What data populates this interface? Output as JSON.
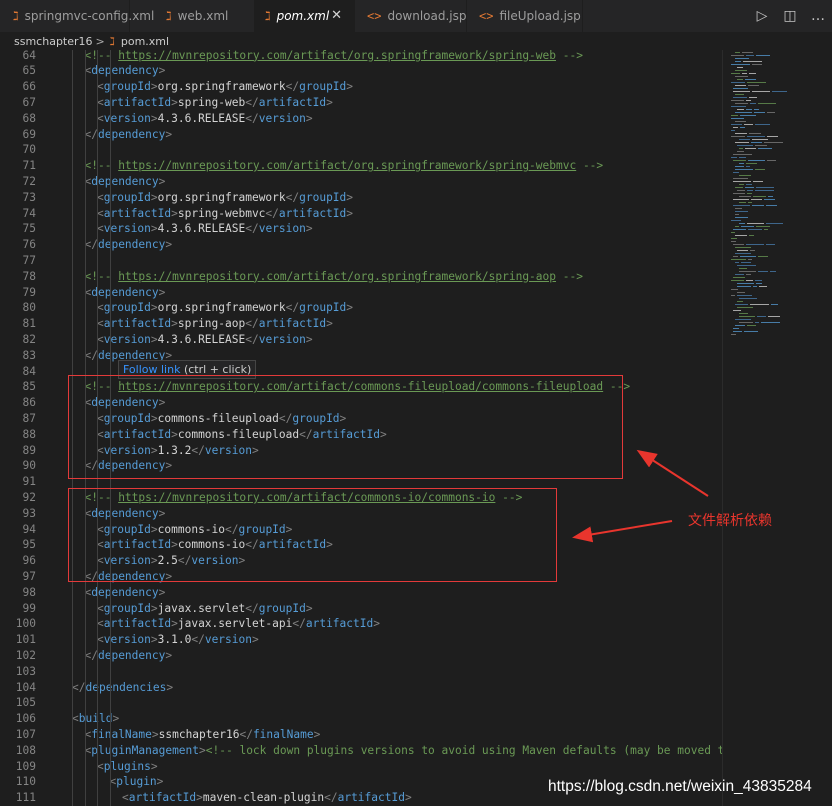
{
  "tabs": [
    {
      "label": "springmvc-config.xml",
      "icon": "xml-file-icon",
      "active": false
    },
    {
      "label": "web.xml",
      "icon": "xml-file-icon",
      "active": false
    },
    {
      "label": "pom.xml",
      "icon": "xml-file-icon",
      "active": true
    },
    {
      "label": "download.jsp",
      "icon": "jsp-file-icon",
      "active": false
    },
    {
      "label": "fileUpload.jsp",
      "icon": "jsp-file-icon",
      "active": false
    }
  ],
  "tab_actions": [
    {
      "icon": "run-icon"
    },
    {
      "icon": "split-editor-icon"
    },
    {
      "icon": "more-actions-icon"
    }
  ],
  "breadcrumb": {
    "folder": "ssmchapter16",
    "separator": ">",
    "file": "pom.xml"
  },
  "tooltip": {
    "link": "Follow link",
    "hint": "(ctrl + click)"
  },
  "annotation": "文件解析依赖",
  "watermark": "https://blog.csdn.net/weixin_43835284",
  "colors": {
    "tag": "#569cd6",
    "comment": "#6a9955",
    "text": "#d4d4d4",
    "punct": "#808080",
    "highlight_box": "#e33a3a",
    "annotation": "#e8352d"
  },
  "lines": [
    {
      "num": "64",
      "indent": 1,
      "tokens": [
        [
          "c",
          "<!-- "
        ],
        [
          "u",
          "https://mvnrepository.com/artifact/org.springframework/spring-web"
        ],
        [
          "c",
          " -->"
        ]
      ]
    },
    {
      "num": "65",
      "indent": 1,
      "tokens": [
        [
          "p",
          "<"
        ],
        [
          "t",
          "dependency"
        ],
        [
          "p",
          ">"
        ]
      ]
    },
    {
      "num": "66",
      "indent": 2,
      "tokens": [
        [
          "p",
          "<"
        ],
        [
          "t",
          "groupId"
        ],
        [
          "p",
          ">"
        ],
        [
          "txt",
          "org.springframework"
        ],
        [
          "p",
          "</"
        ],
        [
          "t",
          "groupId"
        ],
        [
          "p",
          ">"
        ]
      ]
    },
    {
      "num": "67",
      "indent": 2,
      "tokens": [
        [
          "p",
          "<"
        ],
        [
          "t",
          "artifactId"
        ],
        [
          "p",
          ">"
        ],
        [
          "txt",
          "spring-web"
        ],
        [
          "p",
          "</"
        ],
        [
          "t",
          "artifactId"
        ],
        [
          "p",
          ">"
        ]
      ]
    },
    {
      "num": "68",
      "indent": 2,
      "tokens": [
        [
          "p",
          "<"
        ],
        [
          "t",
          "version"
        ],
        [
          "p",
          ">"
        ],
        [
          "txt",
          "4.3.6.RELEASE"
        ],
        [
          "p",
          "</"
        ],
        [
          "t",
          "version"
        ],
        [
          "p",
          ">"
        ]
      ]
    },
    {
      "num": "69",
      "indent": 1,
      "tokens": [
        [
          "p",
          "</"
        ],
        [
          "t",
          "dependency"
        ],
        [
          "p",
          ">"
        ]
      ]
    },
    {
      "num": "70",
      "indent": 0,
      "tokens": []
    },
    {
      "num": "71",
      "indent": 1,
      "tokens": [
        [
          "c",
          "<!-- "
        ],
        [
          "u",
          "https://mvnrepository.com/artifact/org.springframework/spring-webmvc"
        ],
        [
          "c",
          " -->"
        ]
      ]
    },
    {
      "num": "72",
      "indent": 1,
      "tokens": [
        [
          "p",
          "<"
        ],
        [
          "t",
          "dependency"
        ],
        [
          "p",
          ">"
        ]
      ]
    },
    {
      "num": "73",
      "indent": 2,
      "tokens": [
        [
          "p",
          "<"
        ],
        [
          "t",
          "groupId"
        ],
        [
          "p",
          ">"
        ],
        [
          "txt",
          "org.springframework"
        ],
        [
          "p",
          "</"
        ],
        [
          "t",
          "groupId"
        ],
        [
          "p",
          ">"
        ]
      ]
    },
    {
      "num": "74",
      "indent": 2,
      "tokens": [
        [
          "p",
          "<"
        ],
        [
          "t",
          "artifactId"
        ],
        [
          "p",
          ">"
        ],
        [
          "txt",
          "spring-webmvc"
        ],
        [
          "p",
          "</"
        ],
        [
          "t",
          "artifactId"
        ],
        [
          "p",
          ">"
        ]
      ]
    },
    {
      "num": "75",
      "indent": 2,
      "tokens": [
        [
          "p",
          "<"
        ],
        [
          "t",
          "version"
        ],
        [
          "p",
          ">"
        ],
        [
          "txt",
          "4.3.6.RELEASE"
        ],
        [
          "p",
          "</"
        ],
        [
          "t",
          "version"
        ],
        [
          "p",
          ">"
        ]
      ]
    },
    {
      "num": "76",
      "indent": 1,
      "tokens": [
        [
          "p",
          "</"
        ],
        [
          "t",
          "dependency"
        ],
        [
          "p",
          ">"
        ]
      ]
    },
    {
      "num": "77",
      "indent": 0,
      "tokens": []
    },
    {
      "num": "78",
      "indent": 1,
      "tokens": [
        [
          "c",
          "<!-- "
        ],
        [
          "u",
          "https://mvnrepository.com/artifact/org.springframework/spring-aop"
        ],
        [
          "c",
          " -->"
        ]
      ]
    },
    {
      "num": "79",
      "indent": 1,
      "tokens": [
        [
          "p",
          "<"
        ],
        [
          "t",
          "dependency"
        ],
        [
          "p",
          ">"
        ]
      ]
    },
    {
      "num": "80",
      "indent": 2,
      "tokens": [
        [
          "p",
          "<"
        ],
        [
          "t",
          "groupId"
        ],
        [
          "p",
          ">"
        ],
        [
          "txt",
          "org.springframework"
        ],
        [
          "p",
          "</"
        ],
        [
          "t",
          "groupId"
        ],
        [
          "p",
          ">"
        ]
      ]
    },
    {
      "num": "81",
      "indent": 2,
      "tokens": [
        [
          "p",
          "<"
        ],
        [
          "t",
          "artifactId"
        ],
        [
          "p",
          ">"
        ],
        [
          "txt",
          "spring-aop"
        ],
        [
          "p",
          "</"
        ],
        [
          "t",
          "artifactId"
        ],
        [
          "p",
          ">"
        ]
      ]
    },
    {
      "num": "82",
      "indent": 2,
      "tokens": [
        [
          "p",
          "<"
        ],
        [
          "t",
          "version"
        ],
        [
          "p",
          ">"
        ],
        [
          "txt",
          "4.3.6.RELEASE"
        ],
        [
          "p",
          "</"
        ],
        [
          "t",
          "version"
        ],
        [
          "p",
          ">"
        ]
      ]
    },
    {
      "num": "83",
      "indent": 1,
      "tokens": [
        [
          "p",
          "</"
        ],
        [
          "t",
          "dependency"
        ],
        [
          "p",
          ">"
        ]
      ]
    },
    {
      "num": "84",
      "indent": 0,
      "tokens": []
    },
    {
      "num": "85",
      "indent": 1,
      "tokens": [
        [
          "c",
          "<!-- "
        ],
        [
          "u",
          "https://mvnrepository.com/artifact/commons-fileupload/commons-fileupload"
        ],
        [
          "c",
          " -->"
        ]
      ]
    },
    {
      "num": "86",
      "indent": 1,
      "tokens": [
        [
          "p",
          "<"
        ],
        [
          "t",
          "dependency"
        ],
        [
          "p",
          ">"
        ]
      ]
    },
    {
      "num": "87",
      "indent": 2,
      "tokens": [
        [
          "p",
          "<"
        ],
        [
          "t",
          "groupId"
        ],
        [
          "p",
          ">"
        ],
        [
          "txt",
          "commons-fileupload"
        ],
        [
          "p",
          "</"
        ],
        [
          "t",
          "groupId"
        ],
        [
          "p",
          ">"
        ]
      ]
    },
    {
      "num": "88",
      "indent": 2,
      "tokens": [
        [
          "p",
          "<"
        ],
        [
          "t",
          "artifactId"
        ],
        [
          "p",
          ">"
        ],
        [
          "txt",
          "commons-fileupload"
        ],
        [
          "p",
          "</"
        ],
        [
          "t",
          "artifactId"
        ],
        [
          "p",
          ">"
        ]
      ]
    },
    {
      "num": "89",
      "indent": 2,
      "tokens": [
        [
          "p",
          "<"
        ],
        [
          "t",
          "version"
        ],
        [
          "p",
          ">"
        ],
        [
          "txt",
          "1.3.2"
        ],
        [
          "p",
          "</"
        ],
        [
          "t",
          "version"
        ],
        [
          "p",
          ">"
        ]
      ]
    },
    {
      "num": "90",
      "indent": 1,
      "tokens": [
        [
          "p",
          "</"
        ],
        [
          "t",
          "dependency"
        ],
        [
          "p",
          ">"
        ]
      ]
    },
    {
      "num": "91",
      "indent": 0,
      "tokens": []
    },
    {
      "num": "92",
      "indent": 1,
      "tokens": [
        [
          "c",
          "<!-- "
        ],
        [
          "u",
          "https://mvnrepository.com/artifact/commons-io/commons-io"
        ],
        [
          "c",
          " -->"
        ]
      ]
    },
    {
      "num": "93",
      "indent": 1,
      "tokens": [
        [
          "p",
          "<"
        ],
        [
          "t",
          "dependency"
        ],
        [
          "p",
          ">"
        ]
      ]
    },
    {
      "num": "94",
      "indent": 2,
      "tokens": [
        [
          "p",
          "<"
        ],
        [
          "t",
          "groupId"
        ],
        [
          "p",
          ">"
        ],
        [
          "txt",
          "commons-io"
        ],
        [
          "p",
          "</"
        ],
        [
          "t",
          "groupId"
        ],
        [
          "p",
          ">"
        ]
      ]
    },
    {
      "num": "95",
      "indent": 2,
      "tokens": [
        [
          "p",
          "<"
        ],
        [
          "t",
          "artifactId"
        ],
        [
          "p",
          ">"
        ],
        [
          "txt",
          "commons-io"
        ],
        [
          "p",
          "</"
        ],
        [
          "t",
          "artifactId"
        ],
        [
          "p",
          ">"
        ]
      ]
    },
    {
      "num": "96",
      "indent": 2,
      "tokens": [
        [
          "p",
          "<"
        ],
        [
          "t",
          "version"
        ],
        [
          "p",
          ">"
        ],
        [
          "txt",
          "2.5"
        ],
        [
          "p",
          "</"
        ],
        [
          "t",
          "version"
        ],
        [
          "p",
          ">"
        ]
      ]
    },
    {
      "num": "97",
      "indent": 1,
      "tokens": [
        [
          "p",
          "</"
        ],
        [
          "t",
          "dependency"
        ],
        [
          "p",
          ">"
        ]
      ]
    },
    {
      "num": "98",
      "indent": 1,
      "tokens": [
        [
          "p",
          "<"
        ],
        [
          "t",
          "dependency"
        ],
        [
          "p",
          ">"
        ]
      ]
    },
    {
      "num": "99",
      "indent": 2,
      "tokens": [
        [
          "p",
          "<"
        ],
        [
          "t",
          "groupId"
        ],
        [
          "p",
          ">"
        ],
        [
          "txt",
          "javax.servlet"
        ],
        [
          "p",
          "</"
        ],
        [
          "t",
          "groupId"
        ],
        [
          "p",
          ">"
        ]
      ]
    },
    {
      "num": "100",
      "indent": 2,
      "tokens": [
        [
          "p",
          "<"
        ],
        [
          "t",
          "artifactId"
        ],
        [
          "p",
          ">"
        ],
        [
          "txt",
          "javax.servlet-api"
        ],
        [
          "p",
          "</"
        ],
        [
          "t",
          "artifactId"
        ],
        [
          "p",
          ">"
        ]
      ]
    },
    {
      "num": "101",
      "indent": 2,
      "tokens": [
        [
          "p",
          "<"
        ],
        [
          "t",
          "version"
        ],
        [
          "p",
          ">"
        ],
        [
          "txt",
          "3.1.0"
        ],
        [
          "p",
          "</"
        ],
        [
          "t",
          "version"
        ],
        [
          "p",
          ">"
        ]
      ]
    },
    {
      "num": "102",
      "indent": 1,
      "tokens": [
        [
          "p",
          "</"
        ],
        [
          "t",
          "dependency"
        ],
        [
          "p",
          ">"
        ]
      ]
    },
    {
      "num": "103",
      "indent": 0,
      "tokens": []
    },
    {
      "num": "104",
      "indent": 0,
      "tokens": [
        [
          "p",
          "</"
        ],
        [
          "t",
          "dependencies"
        ],
        [
          "p",
          ">"
        ]
      ]
    },
    {
      "num": "105",
      "indent": 0,
      "tokens": []
    },
    {
      "num": "106",
      "indent": 0,
      "tokens": [
        [
          "p",
          "<"
        ],
        [
          "t",
          "build"
        ],
        [
          "p",
          ">"
        ]
      ]
    },
    {
      "num": "107",
      "indent": 1,
      "tokens": [
        [
          "p",
          "<"
        ],
        [
          "t",
          "finalName"
        ],
        [
          "p",
          ">"
        ],
        [
          "txt",
          "ssmchapter16"
        ],
        [
          "p",
          "</"
        ],
        [
          "t",
          "finalName"
        ],
        [
          "p",
          ">"
        ]
      ]
    },
    {
      "num": "108",
      "indent": 1,
      "tokens": [
        [
          "p",
          "<"
        ],
        [
          "t",
          "pluginManagement"
        ],
        [
          "p",
          ">"
        ],
        [
          "c",
          "<!-- lock down plugins versions to avoid using Maven defaults (may be moved to par"
        ]
      ]
    },
    {
      "num": "109",
      "indent": 2,
      "tokens": [
        [
          "p",
          "<"
        ],
        [
          "t",
          "plugins"
        ],
        [
          "p",
          ">"
        ]
      ]
    },
    {
      "num": "110",
      "indent": 3,
      "tokens": [
        [
          "p",
          "<"
        ],
        [
          "t",
          "plugin"
        ],
        [
          "p",
          ">"
        ]
      ]
    },
    {
      "num": "111",
      "indent": 4,
      "tokens": [
        [
          "p",
          "<"
        ],
        [
          "t",
          "artifactId"
        ],
        [
          "p",
          ">"
        ],
        [
          "txt",
          "maven-clean-plugin"
        ],
        [
          "p",
          "</"
        ],
        [
          "t",
          "artifactId"
        ],
        [
          "p",
          ">"
        ]
      ]
    }
  ]
}
